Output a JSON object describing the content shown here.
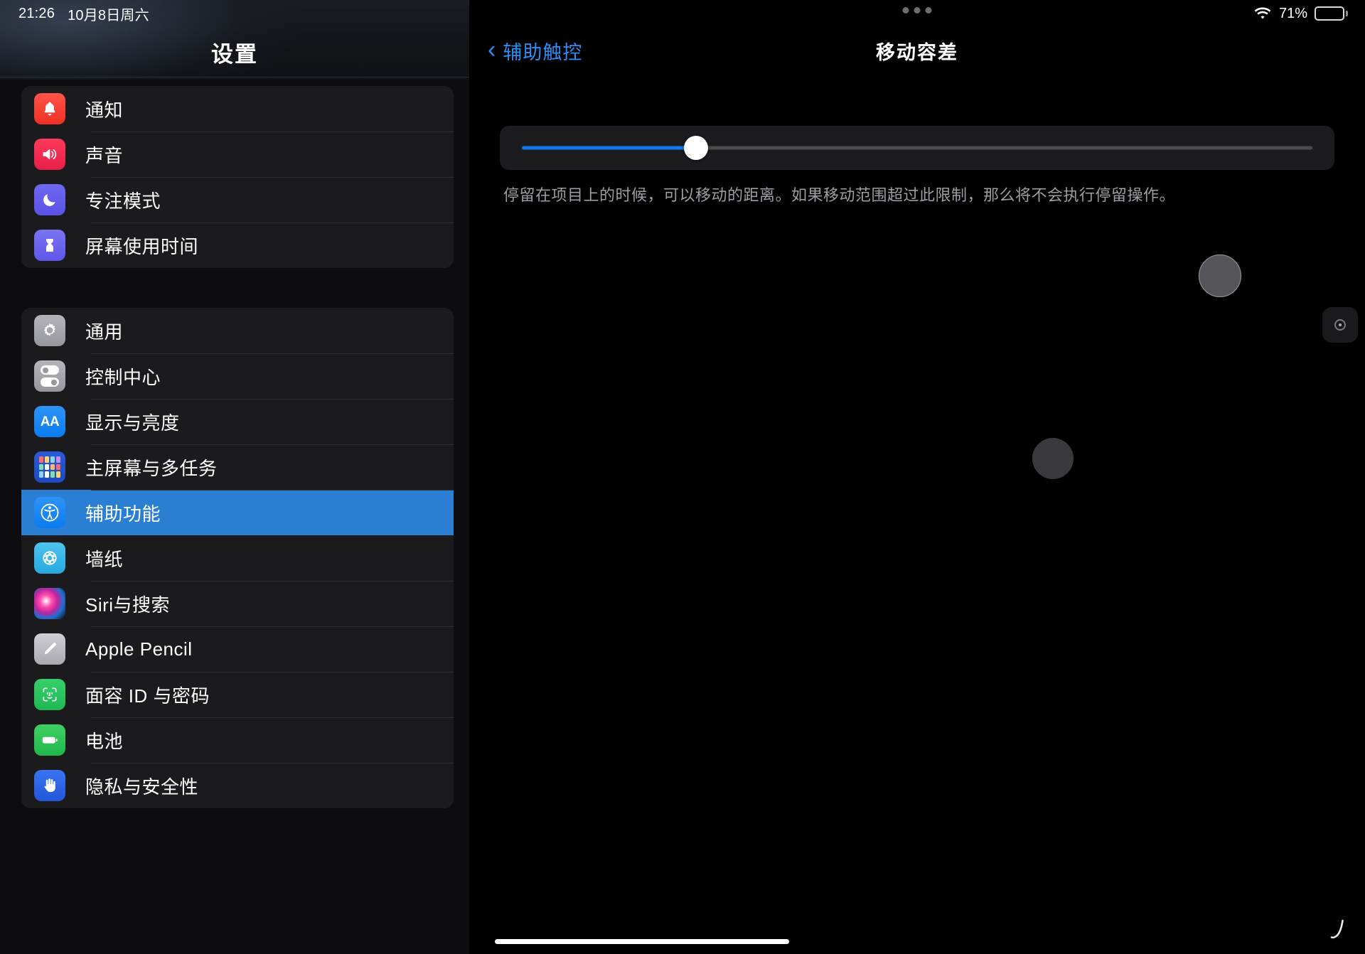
{
  "status_bar": {
    "time": "21:26",
    "date": "10月8日周六",
    "wifi_icon": "wifi-icon",
    "battery_percent": "71%",
    "battery_level": 71
  },
  "sidebar": {
    "title": "设置",
    "selected_item": "辅助功能",
    "selection_color": "#2a7fd4",
    "groups": [
      {
        "items": [
          {
            "label": "通知",
            "icon": "bell-icon",
            "icon_class": "ic-bell",
            "glyph": "🔔"
          },
          {
            "label": "声音",
            "icon": "speaker-icon",
            "icon_class": "ic-sound",
            "glyph": "🔊"
          },
          {
            "label": "专注模式",
            "icon": "moon-icon",
            "icon_class": "ic-focus",
            "glyph": "☾"
          },
          {
            "label": "屏幕使用时间",
            "icon": "hourglass-icon",
            "icon_class": "ic-screen",
            "glyph": "⌛"
          }
        ]
      },
      {
        "items": [
          {
            "label": "通用",
            "icon": "gear-icon",
            "icon_class": "ic-gear",
            "glyph": "⚙"
          },
          {
            "label": "控制中心",
            "icon": "toggles-icon",
            "icon_class": "ic-control",
            "glyph": ""
          },
          {
            "label": "显示与亮度",
            "icon": "text-size-icon",
            "icon_class": "ic-display",
            "glyph": "AA"
          },
          {
            "label": "主屏幕与多任务",
            "icon": "home-screen-icon",
            "icon_class": "ic-home",
            "glyph": ""
          },
          {
            "label": "辅助功能",
            "icon": "accessibility-icon",
            "icon_class": "ic-access",
            "glyph": "Ⓙ"
          },
          {
            "label": "墙纸",
            "icon": "wallpaper-icon",
            "icon_class": "ic-wall",
            "glyph": "✿"
          },
          {
            "label": "Siri与搜索",
            "icon": "siri-icon",
            "icon_class": "ic-siri",
            "glyph": ""
          },
          {
            "label": "Apple Pencil",
            "icon": "pencil-icon",
            "icon_class": "ic-pencil",
            "glyph": "✏"
          },
          {
            "label": "面容 ID 与密码",
            "icon": "face-id-icon",
            "icon_class": "ic-faceid",
            "glyph": "☺"
          },
          {
            "label": "电池",
            "icon": "battery-icon",
            "icon_class": "ic-battery",
            "glyph": "▬"
          },
          {
            "label": "隐私与安全性",
            "icon": "hand-raised-icon",
            "icon_class": "ic-privacy",
            "glyph": "✋"
          }
        ]
      }
    ]
  },
  "detail": {
    "back_label": "辅助触控",
    "back_icon": "chevron-left-icon",
    "title": "移动容差",
    "slider": {
      "name": "movement-tolerance-slider",
      "value_percent": 22,
      "fill_color": "#1278f0",
      "track_color": "#4a4a50",
      "thumb_color": "#ffffff"
    },
    "caption": "停留在项目上的时候，可以移动的距离。如果移动范围超过此限制，那么将不会执行停留操作。",
    "assistive_touch_button": "assistive-touch-button",
    "home_indicator": "home-indicator",
    "pointer": "pointer-cursor"
  }
}
